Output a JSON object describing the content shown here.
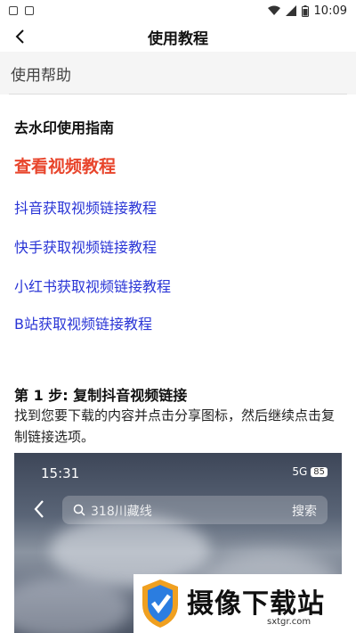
{
  "status_bar": {
    "time": "10:09",
    "icons": [
      "mail-icon",
      "app-icon",
      "wifi-icon",
      "signal-icon",
      "battery-icon"
    ]
  },
  "title_bar": {
    "title": "使用教程",
    "back_icon": "chevron-left-icon"
  },
  "section": {
    "header": "使用帮助"
  },
  "guide": {
    "title": "去水印使用指南",
    "video_link": "查看视频教程",
    "links": [
      "抖音获取视频链接教程",
      "快手获取视频链接教程",
      "小红书获取视频链接教程",
      "B站获取视频链接教程"
    ]
  },
  "step": {
    "title": "第 1 步: 复制抖音视频链接",
    "description": "找到您要下载的内容并点击分享图标，然后继续点击复制链接选项。"
  },
  "screenshot": {
    "time": "15:31",
    "network": "5G",
    "battery": "85",
    "search_placeholder": "318川藏线",
    "search_button": "搜索"
  },
  "watermark": {
    "text": "摄像下载站",
    "domain": "sxtgr.com"
  },
  "colors": {
    "accent_red": "#e8452c",
    "link_blue": "#2a35d6",
    "section_bg": "#f5f5f5"
  }
}
